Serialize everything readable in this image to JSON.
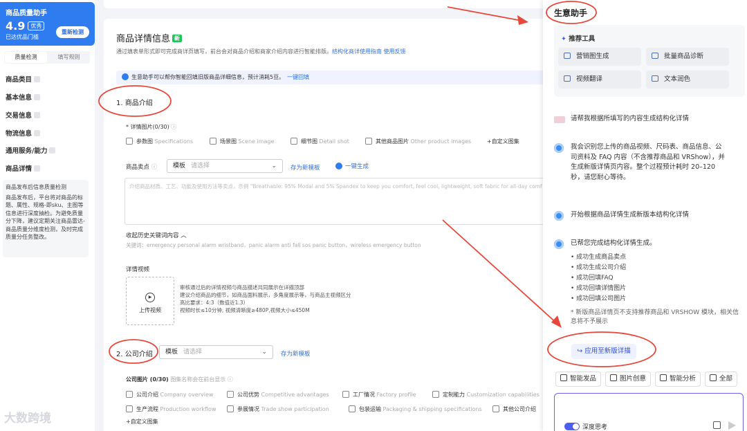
{
  "sidebar": {
    "card_title": "商品质量助手",
    "score": "4.9",
    "score_badge": "优秀",
    "threshold": "已达优品门槛",
    "recheck": "重新检测",
    "tabs": [
      "质量检测",
      "填写规则"
    ],
    "items": [
      "商品类目",
      "基本信息",
      "交易信息",
      "物流信息",
      "通用服务/能力",
      "商品详情"
    ],
    "notice_title": "商品发布后信息质量检测",
    "notice_body": "商品发布后，平台将对商品的标题、属性、规格-即sku、主图等信息进行深度抽检。为避免质量分下降，建议定期关注商品雷达-商品质量分维度检测，及时完成质量分任务整改。",
    "watermark": "大数跨境"
  },
  "main": {
    "title": "商品详情信息",
    "new_badge": "新",
    "desc": "通过填表单形式即可完成商详页填写，前台会对商品介绍和商家介绍内容进行智能排版。",
    "desc_link": "结构化商详使用指南 使用反馈",
    "helper_text": "生意助手可以帮你智能回填旧版商品详细信息，预计消耗5豆。",
    "helper_link": "一键回填",
    "section1": "1. 商品介绍",
    "detail_images_label": "* 详情图片(0/30)",
    "image_types": [
      {
        "cn": "参数图",
        "en": "Specifications"
      },
      {
        "cn": "场景图",
        "en": "Scene image"
      },
      {
        "cn": "细节图",
        "en": "Detail shot"
      },
      {
        "cn": "其他商品图片",
        "en": "Other product images"
      }
    ],
    "custom_image": "+自定义图集",
    "selling_label": "商品卖点",
    "template_label": "模板",
    "template_placeholder": "请选择",
    "save_template": "存为新模板",
    "generate": "一键生成",
    "textarea_placeholder": "介绍商品材质、工艺、功能及使用方法等卖点，示例 \"Breathable: 95% Modal and 5% Spandex to keep you comfort, feel cool, lightweight, soft fabric for all-day comf",
    "history_keywords": "收起历史关键词内容",
    "keywords": "关键词：emergency personal alarm wristband，panic alarm anti fall sos panic button，wireless emergency button",
    "video_label": "详情视频",
    "upload_video": "上传视频",
    "video_notes": [
      "审核通过后的详情视频与商品描述共同展示在详描顶部",
      "建议介绍商品的细节，如商品面料展示，多角度展示等，与商品主视频区分",
      "高比要求：4:3（数值近1.3）",
      "视频时长≤10分钟, 视频清晰度≥480P,视频大小≤450M"
    ],
    "section2": "2. 公司介绍",
    "company_images_label": "公司图片 (0/30)",
    "company_images_hint": "图集名称会在前台显示",
    "company_types": [
      {
        "cn": "公司介绍",
        "en": "Company overview"
      },
      {
        "cn": "公司优势",
        "en": "Competitive advantages"
      },
      {
        "cn": "工厂情况",
        "en": "Factory profile"
      },
      {
        "cn": "定制能力",
        "en": "Customization capabilities"
      },
      {
        "cn": "生产流程",
        "en": "Production workflow"
      },
      {
        "cn": "参展情况",
        "en": "Trade show participation"
      },
      {
        "cn": "包装运输",
        "en": "Packaging & shipping specifications"
      },
      {
        "cn": "其他公司介绍",
        "en": ""
      }
    ],
    "custom_company": "+自定义图集"
  },
  "assistant": {
    "title": "生意助手",
    "tools_head": "推荐工具",
    "tools": [
      "营销图生成",
      "批量商品诊断",
      "视频翻译",
      "文本润色"
    ],
    "user_msg": "请帮我根据所填写的内容生成结构化详情",
    "bot_msg1": "我会识别您上传的商品视频、尺码表、商品信息、公司资料及 FAQ 内容（不含推荐商品和 VRShow），并生成新版详情页内容。整个过程预计耗时 20–120 秒，请您耐心等待。",
    "bot_msg2": "开始根据商品详情生成新版本结构化详情",
    "bot_msg3": "已帮您完成结构化详情生成。",
    "results": [
      "成功生成商品卖点",
      "成功生成公司介绍",
      "成功回填FAQ",
      "成功回填详情图片",
      "成功回填公司图片"
    ],
    "caveat": "* 新版商品详情页不支持推荐商品和 VRSHOW 模块，相关信息将不予展示",
    "apply": "↪ 应用至新版详描",
    "chips": [
      "智能发品",
      "图片创意",
      "智能分析",
      "全部"
    ],
    "deep_think": "深度思考"
  },
  "colors": {
    "accent": "#2f7bf0",
    "annotation": "#e8483b",
    "new_badge": "#1ec45a"
  }
}
